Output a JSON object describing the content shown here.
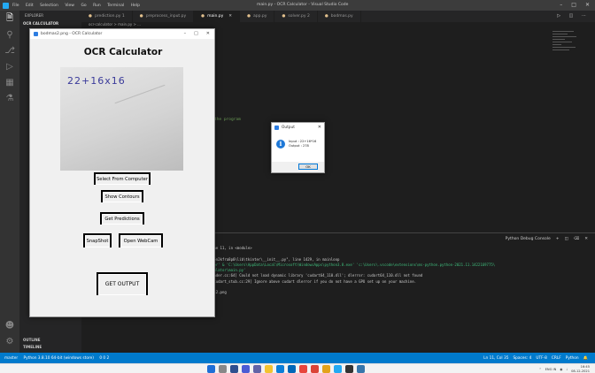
{
  "vscode": {
    "title": "main.py - OCR Calculator - Visual Studio Code",
    "menu": [
      "File",
      "Edit",
      "Selection",
      "View",
      "Go",
      "Run",
      "Terminal",
      "Help"
    ],
    "explorer_title": "EXPLORER",
    "open_folder": "OCR CALCULATOR",
    "outline_label": "OUTLINE",
    "timeline_label": "TIMELINE",
    "tabs": [
      {
        "label": "prediction.py 1",
        "active": false
      },
      {
        "label": "preprocess_input.py",
        "active": false
      },
      {
        "label": "main.py",
        "active": true
      },
      {
        "label": "app.py",
        "active": false
      },
      {
        "label": "solver.py 2",
        "active": false
      },
      {
        "label": "bodmas.py",
        "active": false
      }
    ],
    "breadcrumb": "ocr-calculator > main.py > ...",
    "editor_comment": "the program",
    "panel_terminal": "Python Debug Console",
    "terminal_lines": [
      "                 ...nding Projects\\OCR Calculator\\main.py\", line 11, in <module>",
      "",
      "                 ...lator\\app.py\", line 91, in __init__",
      "",
      "                 ...nvaData\\Loc.Python.3.8_3.8.2800.0_x64__qbz5n2kfra8p0\\lib\\tkinter\\__init__.py\", line 1429, in mainloop",
      "",
      "",
      "                 ...nding Projects\\OCR Calculator\\ocr-calculator' & 'C:\\Users\\AppData\\Local\\Microsoft\\WindowsApps\\python3.8.exe' 'c:\\Users\\.vscode\\extensions\\ms-python.python-2021.11.1422169775\\",
      "                 ...a Pending Projects\\OCR Calculator\\ocr-calculator\\main.py'",
      "                 ...ow\\stream_executor\\platform\\default\\dso_loader.cc:64] Could not load dynamic library 'cudart64_110.dll'; dlerror: cudart64_110.dll not found",
      "2021-12-08 16:43:11.280000: I tensorflow\\stream_executor\\cuda\\cudart_stub.cc:29] Ignore above cudart dlerror if you do not have a GPU set up on your machine.",
      "2.6.0-dev20211130",
      "A:\\Pending Projects\\OCR Calculator\\ocr-calculator\\Images\\bodmas2.png",
      "22+16*16",
      "278",
      "[]"
    ],
    "status_left": [
      "master",
      "Python 3.8.10 64-bit (windows store)",
      "0  0  2"
    ],
    "status_right": [
      "Ln 11, Col 35",
      "Spaces: 4",
      "UTF-8",
      "CRLF",
      "Python"
    ]
  },
  "ocr_window": {
    "title": "bodmas2.png - OCR Calculator",
    "heading": "OCR Calculator",
    "image_text": "22+16x16",
    "buttons": {
      "select": "Select From Computer",
      "contours": "Show Contours",
      "predictions": "Get Predictions",
      "snapshot": "SnapShot",
      "webcam": "Open WebCam",
      "output": "GET OUTPUT"
    }
  },
  "output_dialog": {
    "title": "Output",
    "line1": "Input : 22+16*16",
    "line2": "Output : 278",
    "ok": "OK"
  },
  "taskbar": {
    "lang": "ENG\nIN",
    "time": "16:45",
    "date": "08-12-2021"
  },
  "colors": {
    "vscode_bg": "#1e1e1e",
    "statusbar": "#007acc",
    "info_icon": "#1e78d7"
  }
}
